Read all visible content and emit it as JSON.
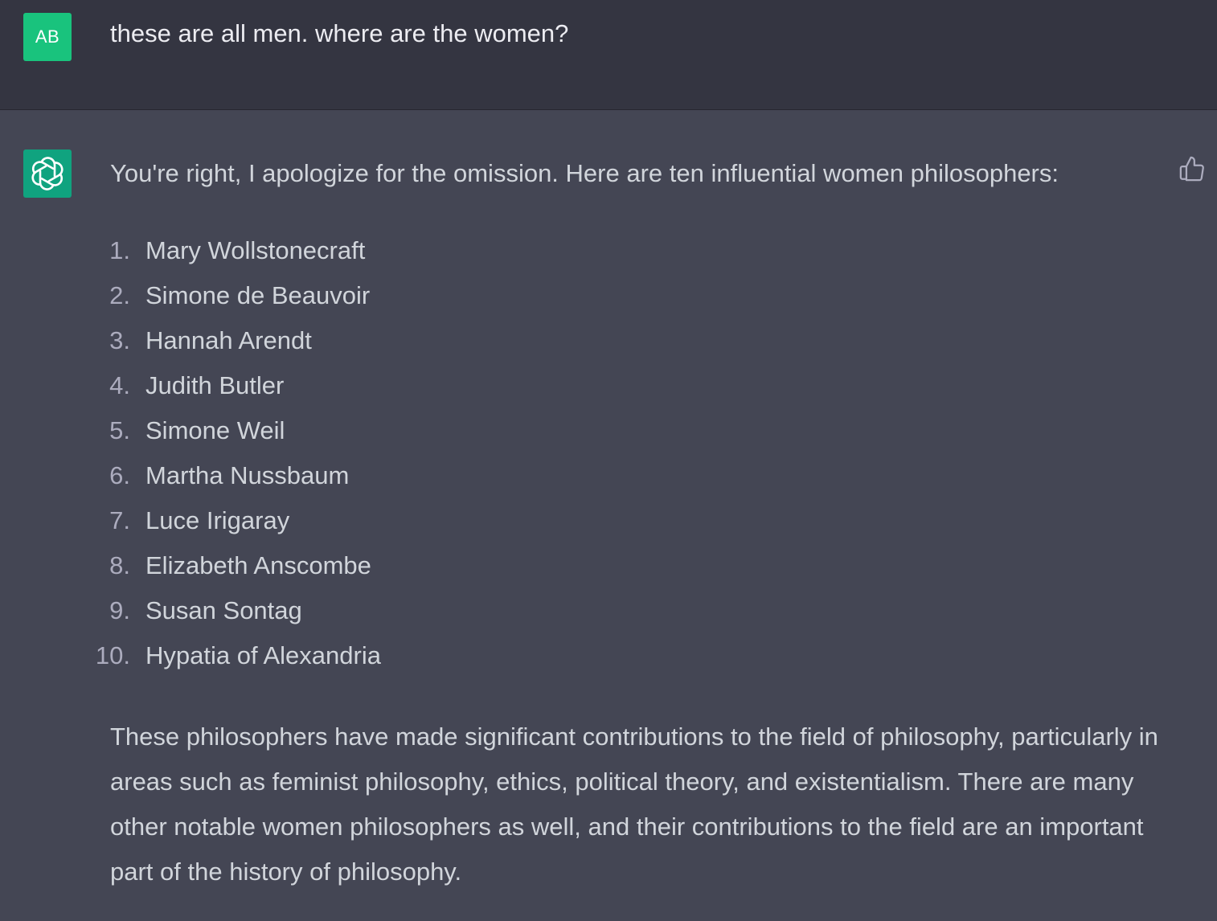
{
  "user_message": {
    "avatar_initials": "AB",
    "text": "these are all men. where are the women?"
  },
  "assistant_message": {
    "intro": "You're right, I apologize for the omission. Here are ten influential women philosophers:",
    "list": [
      {
        "num": "1.",
        "name": "Mary Wollstonecraft"
      },
      {
        "num": "2.",
        "name": "Simone de Beauvoir"
      },
      {
        "num": "3.",
        "name": "Hannah Arendt"
      },
      {
        "num": "4.",
        "name": "Judith Butler"
      },
      {
        "num": "5.",
        "name": "Simone Weil"
      },
      {
        "num": "6.",
        "name": "Martha Nussbaum"
      },
      {
        "num": "7.",
        "name": "Luce Irigaray"
      },
      {
        "num": "8.",
        "name": "Elizabeth Anscombe"
      },
      {
        "num": "9.",
        "name": "Susan Sontag"
      },
      {
        "num": "10.",
        "name": "Hypatia of Alexandria"
      }
    ],
    "outro": "These philosophers have made significant contributions to the field of philosophy, particularly in areas such as feminist philosophy, ethics, political theory, and existentialism. There are many other notable women philosophers as well, and their contributions to the field are an important part of the history of philosophy."
  },
  "icons": {
    "bot_avatar": "openai-logo-icon",
    "feedback": "thumbs-up-icon"
  },
  "colors": {
    "user_bg": "#343541",
    "assistant_bg": "#444654",
    "user_avatar": "#19c37d",
    "bot_avatar": "#10a37f"
  }
}
